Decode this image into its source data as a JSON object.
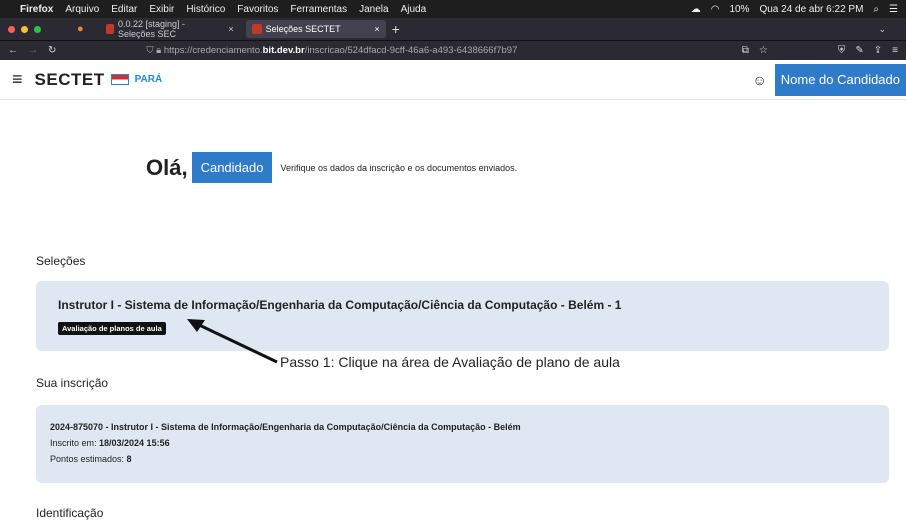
{
  "macbar": {
    "apple": "",
    "app": "Firefox",
    "menus": [
      "Arquivo",
      "Editar",
      "Exibir",
      "Histórico",
      "Favoritos",
      "Ferramentas",
      "Janela",
      "Ajuda"
    ],
    "battery": "10%",
    "datetime": "Qua 24 de abr 6:22 PM"
  },
  "tabs": [
    {
      "label": "0.0.22 [staging] - Seleções SEC"
    },
    {
      "label": "Seleções SECTET"
    }
  ],
  "url": {
    "prefix": "https://credenciamento.",
    "domain": "bit.dev.br",
    "path": "/inscricao/524dfacd-9cff-46a6-a493-6438666f7b97"
  },
  "header": {
    "logo": "SECTET",
    "logo_sub": "PARÁ",
    "user_button": "Nome do Candidado"
  },
  "greeting": {
    "hello": "Olá,",
    "name": "Candidado",
    "subtitle": "Verifique os dados da inscrição e os documentos enviados."
  },
  "selecoes": {
    "title": "Seleções",
    "card_title": "Instrutor I - Sistema de Informação/Engenharia da Computação/Ciência da Computação - Belém - 1",
    "badge": "Avaliação de planos de aula"
  },
  "annotation": "Passo 1: Clique na área de Avaliação de plano de aula",
  "inscricao": {
    "title": "Sua inscrição",
    "line1": "2024-875070 - Instrutor I - Sistema de Informação/Engenharia da Computação/Ciência da Computação - Belém",
    "inscrito_label": "Inscrito em: ",
    "inscrito_value": "18/03/2024 15:56",
    "pontos_label": "Pontos estimados: ",
    "pontos_value": "8"
  },
  "identificacao": {
    "title": "Identificação"
  }
}
